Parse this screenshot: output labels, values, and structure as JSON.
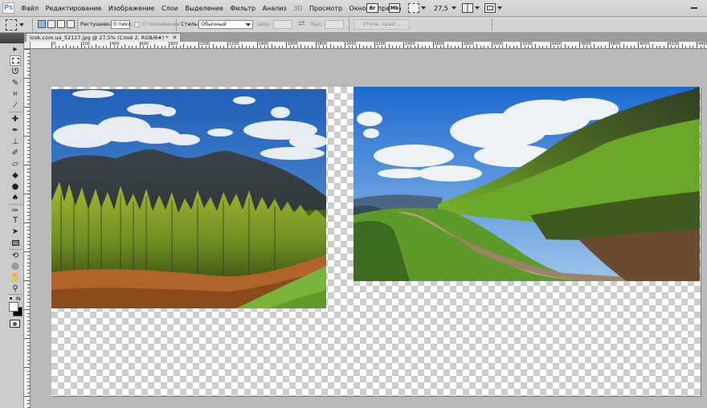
{
  "app": {
    "logo": "Ps"
  },
  "menu": [
    "Файл",
    "Редактирование",
    "Изображение",
    "Слои",
    "Выделение",
    "Фильтр",
    "Анализ",
    "3D",
    "Просмотр",
    "Окно",
    "Справка"
  ],
  "menubar_icons": [
    "mini-bridge-icon",
    "mb-icon",
    "extras-icon",
    "zoom-level-dropdown",
    "arrange-documents-icon",
    "screen-mode-icon"
  ],
  "zoom_level": "27,5",
  "options": {
    "feather_label": "Растушевка:",
    "feather_value": "0 пикс.",
    "antialias_label": "Сглаживание",
    "style_label": "Стиль:",
    "style_value": "Обычный",
    "width_label": "Шир.:",
    "height_label": "Выс.:",
    "refine_edge": "Уточн. край..."
  },
  "document": {
    "tab_title": "look.com.ua_52127.jpg @ 27,5% (Слой 2, RGB/8#) *",
    "ruler_labels": [
      "0",
      "200",
      "400",
      "600",
      "800",
      "1000",
      "1200",
      "1400",
      "1600",
      "1800",
      "2000",
      "2200",
      "2400",
      "2600",
      "2800",
      "3000",
      "3200",
      "3400",
      "3600",
      "3800",
      "4000",
      "4200",
      "4400"
    ]
  },
  "photos": [
    {
      "name": "forest-mountain-photo",
      "subject": "larch forest below a dark mountain ridge under a blue sky with cumulus clouds"
    },
    {
      "name": "mountain-road-photo",
      "subject": "dirt road winding through green mountain slopes under a blue sky with clouds"
    }
  ],
  "colors": {
    "menubar": "#cfcfcf",
    "toolbox": "#cbcbcb",
    "workspace": "#b9b9b9",
    "checker_dark": "#cccccc",
    "checker_light": "#ffffff"
  }
}
